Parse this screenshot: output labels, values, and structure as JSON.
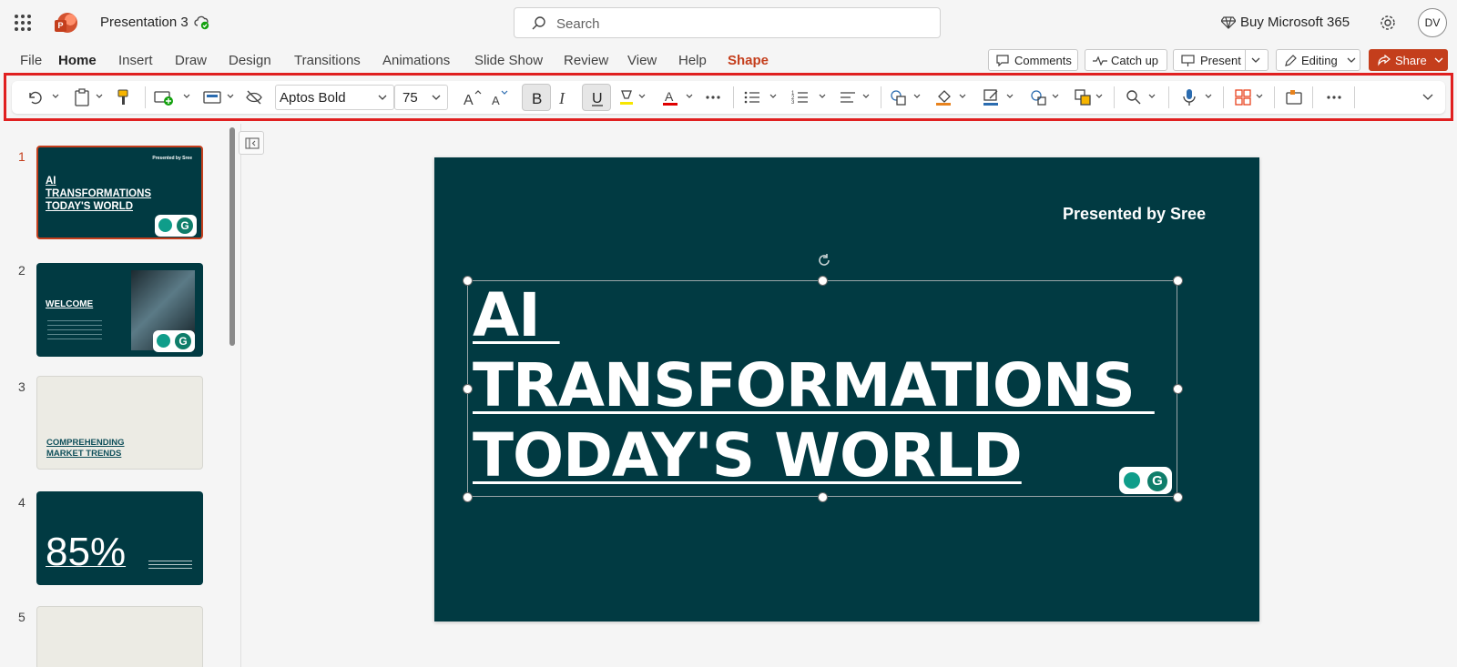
{
  "titlebar": {
    "doc_title": "Presentation 3",
    "search_placeholder": "Search",
    "buy_label": "Buy Microsoft 365",
    "avatar_initials": "DV"
  },
  "tabs": [
    "File",
    "Home",
    "Insert",
    "Draw",
    "Design",
    "Transitions",
    "Animations",
    "Slide Show",
    "Review",
    "View",
    "Help",
    "Shape"
  ],
  "active_tab": "Home",
  "actions": {
    "comments": "Comments",
    "catchup": "Catch up",
    "present": "Present",
    "editing": "Editing",
    "share": "Share"
  },
  "ribbon": {
    "font_name": "Aptos Bold",
    "font_size": "75",
    "bold_active": true,
    "underline_active": true
  },
  "slides": [
    {
      "num": "1",
      "presented": "Presented by Sree",
      "title_lines": [
        "AI",
        "TRANSFORMATIONS",
        "TODAY'S WORLD"
      ],
      "selected": true
    },
    {
      "num": "2",
      "title": "WELCOME"
    },
    {
      "num": "3",
      "title_lines": [
        "COMPREHENDING",
        "MARKET TRENDS"
      ]
    },
    {
      "num": "4",
      "big": "85%"
    },
    {
      "num": "5"
    }
  ],
  "current_slide": {
    "presented": "Presented by  Sree",
    "title": "AI \nTRANSFORMATIONS \nTODAY'S WORLD"
  },
  "colors": {
    "slide_bg": "#013a42",
    "accent": "#c43e1c",
    "highlight_border": "#e02020"
  }
}
